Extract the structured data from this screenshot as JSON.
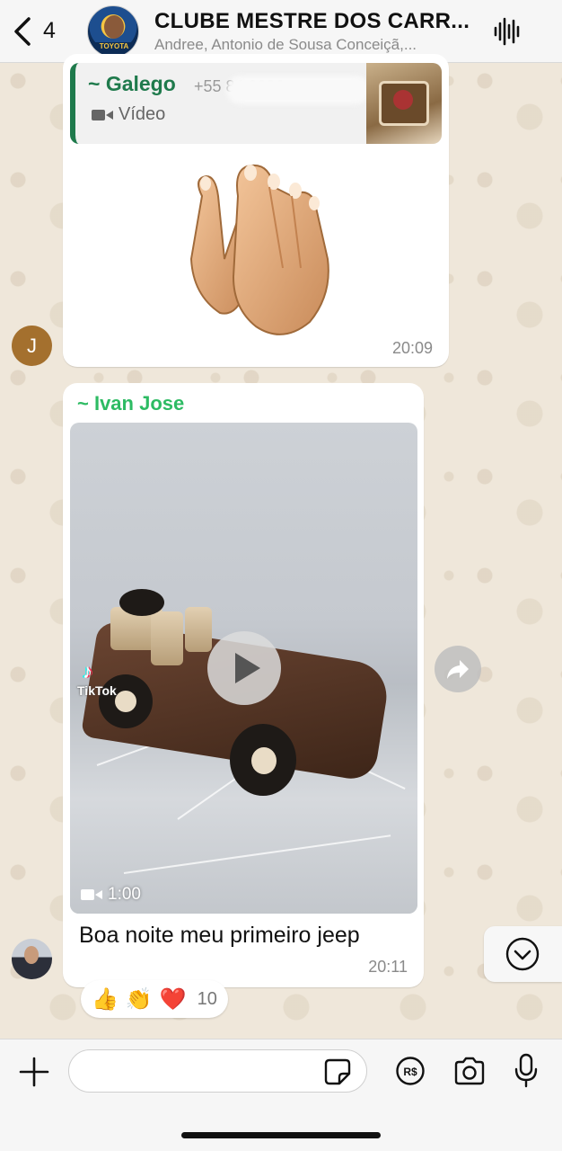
{
  "header": {
    "back_count": "4",
    "group_title": "CLUBE MESTRE DOS CARR...",
    "group_subtitle": "Andree, Antonio de Sousa Conceiçã,...",
    "avatar_text": "TOYOTA"
  },
  "messages": [
    {
      "quoted": {
        "sender": "~ Galego",
        "phone": "+55 84 9996",
        "type_label": "Vídeo"
      },
      "content": "clapping-hands-sticker",
      "time": "20:09",
      "author_initial": "J"
    },
    {
      "sender": "~ Ivan Jose",
      "video": {
        "watermark": "TikTok",
        "duration": "1:00"
      },
      "caption": "Boa noite meu primeiro jeep",
      "time": "20:11",
      "reactions": {
        "emojis": [
          "👍",
          "👏",
          "❤️"
        ],
        "count": "10"
      }
    }
  ],
  "composer": {
    "placeholder": ""
  },
  "colors": {
    "quote_accent": "#1f7a4c",
    "sender_green": "#2dbb63",
    "chat_background": "#efe7da",
    "avatar_j": "#a4702e"
  },
  "icons": [
    "chevron-left-icon",
    "waveform-icon",
    "video-icon",
    "play-icon",
    "forward-icon",
    "chevron-down-icon",
    "plus-icon",
    "sticker-icon",
    "payment-icon",
    "camera-icon",
    "microphone-icon"
  ]
}
